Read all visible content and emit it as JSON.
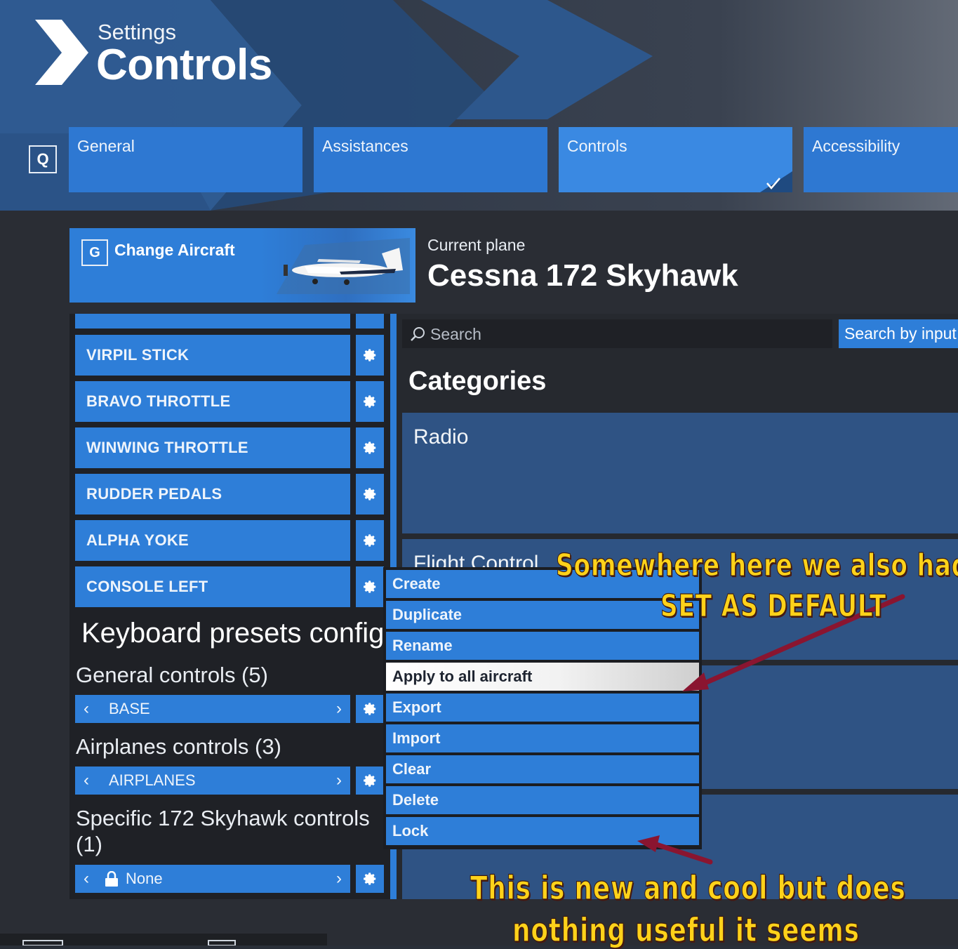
{
  "header": {
    "breadcrumb": "Settings",
    "title": "Controls"
  },
  "tabs": {
    "hotkey_left": "Q",
    "items": [
      {
        "label": "General"
      },
      {
        "label": "Assistances"
      },
      {
        "label": "Controls",
        "active": true
      },
      {
        "label": "Accessibility"
      }
    ]
  },
  "aircraft": {
    "hotkey": "G",
    "change_label": "Change Aircraft",
    "current_label": "Current plane",
    "current_value": "Cessna 172 Skyhawk"
  },
  "devices": {
    "items": [
      {
        "label": "VIRPIL STICK"
      },
      {
        "label": "BRAVO THROTTLE"
      },
      {
        "label": "WINWING THROTTLE"
      },
      {
        "label": "RUDDER PEDALS"
      },
      {
        "label": "ALPHA YOKE"
      },
      {
        "label": "CONSOLE LEFT"
      }
    ]
  },
  "presets": {
    "title": "Keyboard presets config",
    "general_label": "General controls (5)",
    "general_value": "BASE",
    "airplanes_label": "Airplanes controls (3)",
    "airplanes_value": "AIRPLANES",
    "specific_label_line1": "Specific 172 Skyhawk controls",
    "specific_label_line2": "(1)",
    "specific_value": "None"
  },
  "search": {
    "placeholder": "Search",
    "by_input_label": "Search by input"
  },
  "categories": {
    "title": "Categories",
    "items": [
      {
        "label": "Radio"
      },
      {
        "label": "Flight Control"
      }
    ]
  },
  "context_menu": {
    "items": [
      {
        "label": "Create"
      },
      {
        "label": "Duplicate"
      },
      {
        "label": "Rename"
      },
      {
        "label": "Apply to all aircraft",
        "highlighted": true
      },
      {
        "label": "Export"
      },
      {
        "label": "Import"
      },
      {
        "label": "Clear"
      },
      {
        "label": "Delete"
      },
      {
        "label": "Lock"
      }
    ]
  },
  "annotations": {
    "top_line1": "Somewhere here we also had",
    "top_line2": "SET AS DEFAULT",
    "bottom_line1": "This is new and cool but does",
    "bottom_line2": "nothing useful it seems",
    "text_color": "#ffd21a",
    "arrow_color": "#8a1530"
  },
  "colors": {
    "accent_blue": "#2e7ed8",
    "panel_dark": "#1f2126",
    "category_blue": "#2f5384"
  }
}
